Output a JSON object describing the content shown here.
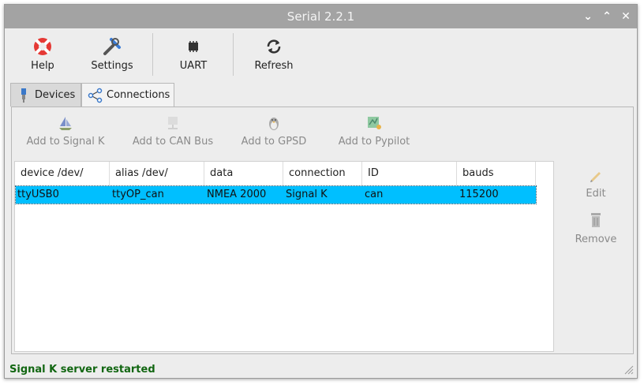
{
  "window": {
    "title": "Serial 2.2.1"
  },
  "toolbar": {
    "help": "Help",
    "settings": "Settings",
    "uart": "UART",
    "refresh": "Refresh"
  },
  "tabs": [
    {
      "label": "Devices",
      "icon": "usb-plug-icon"
    },
    {
      "label": "Connections",
      "icon": "share-icon"
    }
  ],
  "actions": {
    "add_signalk": "Add to Signal K",
    "add_can": "Add to CAN Bus",
    "add_gpsd": "Add to GPSD",
    "add_pypilot": "Add to Pypilot"
  },
  "table": {
    "columns": [
      "device /dev/",
      "alias /dev/",
      "data",
      "connection",
      "ID",
      "bauds"
    ],
    "rows": [
      [
        "ttyUSB0",
        "ttyOP_can",
        "NMEA 2000",
        "Signal K",
        "can",
        "115200"
      ]
    ],
    "selected_row": 0
  },
  "side": {
    "edit": "Edit",
    "remove": "Remove"
  },
  "status": {
    "text": "Signal K server restarted",
    "color": "#116611"
  },
  "colors": {
    "selection": "#00bfff",
    "titlebar": "#a3a3a3"
  }
}
